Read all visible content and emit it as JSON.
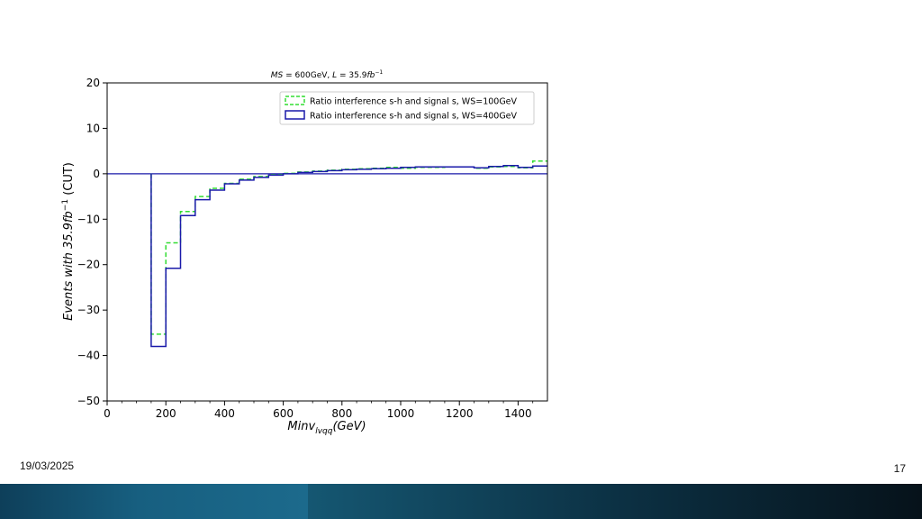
{
  "slide": {
    "date": "19/03/2025",
    "page_number": "17"
  },
  "colors": {
    "series_ws100": "#33dd33",
    "series_ws400": "#1a1aaa",
    "axes": "#000000",
    "zero_line": "#1a1aaa",
    "footer_left": "#1a6a8c",
    "footer_right": "#06121a"
  },
  "chart_data": {
    "type": "line",
    "title_parts": {
      "a": "MS",
      "b": " = 600GeV,  ",
      "c": "L",
      "d": " = 35.9",
      "e": "fb",
      "f": "−1"
    },
    "title": "MS = 600GeV, L = 35.9fb^-1",
    "xlabel_parts": {
      "a": "Minv",
      "b": "lvqq",
      "c": "(GeV)"
    },
    "xlabel": "Minv_lvqq(GeV)",
    "ylabel_parts": {
      "a": "Events with 35.9",
      "b": "fb",
      "c": "−1",
      "d": " (CUT)"
    },
    "ylabel": "Events with 35.9fb^-1 (CUT)",
    "xlim": [
      0,
      1500
    ],
    "ylim": [
      -50,
      20
    ],
    "xticks": [
      0,
      200,
      400,
      600,
      800,
      1000,
      1200,
      1400
    ],
    "yticks": [
      20,
      10,
      0,
      -10,
      -20,
      -30,
      -40,
      -50
    ],
    "ytick_labels": [
      "20",
      "10",
      "0",
      "−10",
      "−20",
      "−30",
      "−40",
      "−50"
    ],
    "grid": false,
    "legend_position": "top-right",
    "bin_edges": [
      150,
      200,
      250,
      300,
      350,
      400,
      450,
      500,
      550,
      600,
      650,
      700,
      750,
      800,
      850,
      900,
      950,
      1000,
      1050,
      1100,
      1150,
      1200,
      1250,
      1300,
      1350,
      1400,
      1450,
      1500
    ],
    "series": [
      {
        "name": "Ratio interference s-h and signal s,  WS=100GeV",
        "style": "dashed",
        "values": [
          -35.3,
          -15.2,
          -8.3,
          -5.0,
          -3.2,
          -2.1,
          -1.2,
          -0.6,
          -0.2,
          0.1,
          0.4,
          0.6,
          0.8,
          1.0,
          1.1,
          1.2,
          1.4,
          1.2,
          1.4,
          1.4,
          1.5,
          1.5,
          1.2,
          1.5,
          1.6,
          1.3,
          2.8
        ]
      },
      {
        "name": "Ratio interference s-h and signal s,  WS=400GeV",
        "style": "solid",
        "values": [
          -38.0,
          -20.8,
          -9.2,
          -5.7,
          -3.6,
          -2.2,
          -1.4,
          -0.8,
          -0.3,
          0.0,
          0.3,
          0.5,
          0.7,
          0.9,
          1.0,
          1.1,
          1.2,
          1.4,
          1.5,
          1.5,
          1.5,
          1.5,
          1.3,
          1.6,
          1.8,
          1.4,
          1.7
        ]
      }
    ],
    "reference_line": {
      "y": 0
    }
  }
}
